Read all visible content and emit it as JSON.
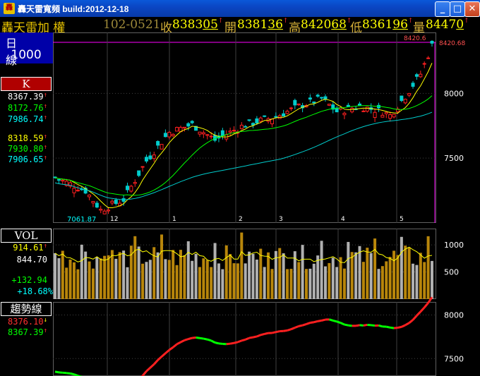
{
  "window": {
    "title": "轟天雷寬頻 build:2012-12-18",
    "app_icon": "轟",
    "min_label": "_",
    "max_label": "□",
    "close_label": "✕"
  },
  "quote": {
    "name": "轟天雷加  權",
    "code": "102-0521",
    "close_label": "收",
    "close_value": "8383",
    "close_dec": "05",
    "open_label": "開",
    "open_value": "8381",
    "open_dec": "36",
    "high_label": "高",
    "high_value": "8420",
    "high_dec": "68",
    "low_label": "低",
    "low_value": "8361",
    "low_dec": "96",
    "vol_label": "量",
    "vol_value": "8447",
    "vol_dec": "0",
    "arrow": "↑"
  },
  "period": {
    "label": "日 線",
    "scale": ".1000"
  },
  "panel_k": {
    "label": "K",
    "values": [
      {
        "v": "8367.39",
        "arrow": "↑",
        "color": "#ffffff"
      },
      {
        "v": "8172.76",
        "arrow": "↑",
        "color": "#00ff00"
      },
      {
        "v": "7986.74",
        "arrow": "↑",
        "color": "#00ffff"
      },
      {
        "v": "8318.59",
        "arrow": "↑",
        "color": "#ffff00"
      },
      {
        "v": "7930.80",
        "arrow": "↑",
        "color": "#00ff00"
      },
      {
        "v": "7906.65",
        "arrow": "↑",
        "color": "#00ffff"
      }
    ]
  },
  "panel_vol": {
    "label": "VOL",
    "values": [
      {
        "v": "914.61",
        "arrow": "↑",
        "color": "#ffff00"
      },
      {
        "v": "844.70",
        "arrow": "",
        "color": "#ffffff"
      },
      {
        "v": "+132.94",
        "arrow": "",
        "color": "#00ff00"
      },
      {
        "v": "+18.68%",
        "arrow": "",
        "color": "#00ffff"
      }
    ]
  },
  "panel_trend": {
    "label": "趨勢線",
    "values": [
      {
        "v": "8376.10",
        "arrow": "↓",
        "color": "#ff3030"
      },
      {
        "v": "8367.39",
        "arrow": "↑",
        "color": "#00ff00"
      }
    ]
  },
  "colors": {
    "up": "#ff2020",
    "down": "#00cccc",
    "ma_fast": "#ffff00",
    "ma_mid": "#00ff00",
    "ma_slow": "#00cccc",
    "vol_up": "#b8860b",
    "vol_down": "#b0b0b0",
    "grid": "#404040",
    "border": "#ff00ff"
  },
  "chart_data": [
    {
      "type": "candlestick",
      "title": "",
      "x_months": [
        "12",
        "1",
        "2",
        "3",
        "4",
        "5"
      ],
      "y_ticks": [
        7500,
        8000
      ],
      "ylim": [
        7000,
        8470
      ],
      "high_label": "8420.68",
      "high_marker": "8420.6",
      "low_label": "7061.87",
      "grid": true
    },
    {
      "type": "bar",
      "title": "",
      "series": [
        {
          "name": "VOL"
        }
      ],
      "y_ticks": [
        500,
        1000
      ],
      "ylim": [
        0,
        1300
      ],
      "grid": true
    },
    {
      "type": "line",
      "title": "",
      "series": [
        {
          "name": "趨勢線"
        }
      ],
      "y_ticks": [
        7500,
        8000
      ],
      "ylim": [
        7300,
        8150
      ],
      "grid": true
    }
  ]
}
